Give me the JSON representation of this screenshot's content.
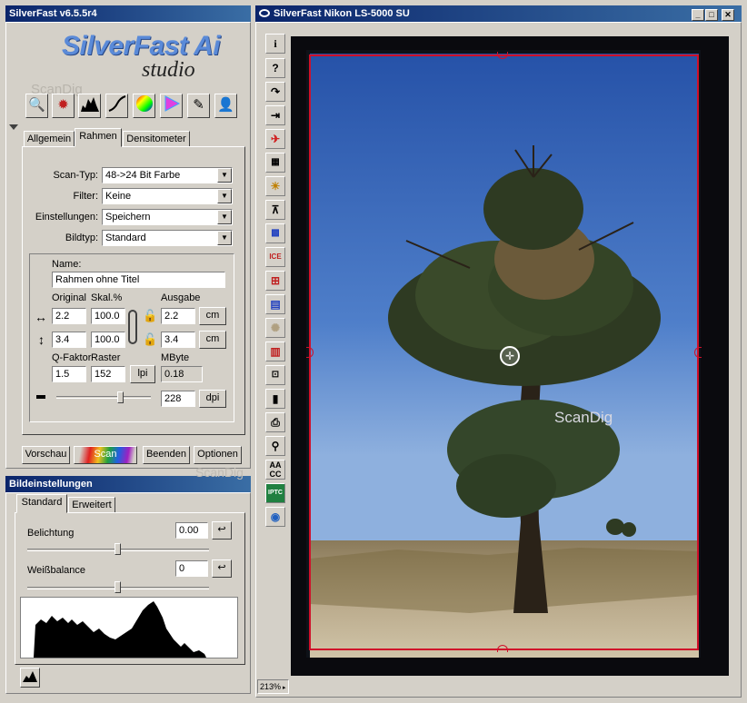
{
  "left_window": {
    "title": "SilverFast v6.5.5r4",
    "logo_main": "SilverFast Ai",
    "logo_sub": "studio",
    "watermark": "ScanDig",
    "tabs": [
      "Allgemein",
      "Rahmen",
      "Densitometer"
    ],
    "active_tab": "Rahmen",
    "scan_typ_label": "Scan-Typ:",
    "scan_typ_value": "48->24 Bit Farbe",
    "filter_label": "Filter:",
    "filter_value": "Keine",
    "einstellungen_label": "Einstellungen:",
    "einstellungen_value": "Speichern",
    "bildtyp_label": "Bildtyp:",
    "bildtyp_value": "Standard",
    "name_label": "Name:",
    "name_value": "Rahmen ohne Titel",
    "col_original": "Original",
    "col_skal": "Skal.%",
    "col_ausgabe": "Ausgabe",
    "width_original": "2.2",
    "width_skal": "100.0",
    "width_ausgabe": "2.2",
    "width_unit": "cm",
    "height_original": "3.4",
    "height_skal": "100.0",
    "height_ausgabe": "3.4",
    "height_unit": "cm",
    "qfaktor_label": "Q-Faktor",
    "raster_label": "Raster",
    "mbyte_label": "MByte",
    "qfaktor_value": "1.5",
    "raster_value": "152",
    "raster_unit": "lpi",
    "mbyte_value": "0.18",
    "resolution_value": "228",
    "resolution_unit": "dpi",
    "resolution_slider_level": 0.68,
    "btn_vorschau": "Vorschau",
    "btn_scan": "Scan",
    "btn_beenden": "Beenden",
    "btn_optionen": "Optionen"
  },
  "bild_panel": {
    "title": "Bildeinstellungen",
    "tabs": [
      "Standard",
      "Erweitert"
    ],
    "belichtung_label": "Belichtung",
    "belichtung_value": "0.00",
    "belichtung_level": 0.5,
    "weissbalance_label": "Weißbalance",
    "weissbalance_value": "0",
    "weissbalance_level": 0.5,
    "watermark": "ScanDig"
  },
  "right_window": {
    "title": "SilverFast Nikon LS-5000 SU",
    "zoom": "213%",
    "watermark": "ScanDig",
    "colors": {
      "frame": "#d0102a",
      "sky_top": "#2f5fb8",
      "sky_bottom": "#7fa3d6",
      "ground": "#b9a889",
      "titlebar": "#0a246a"
    }
  },
  "toolbar_icons": [
    "zoom-icon",
    "aperture-icon",
    "histogram-icon",
    "gradation-curve-icon",
    "color-wheel-icon",
    "selective-color-icon",
    "pipette-icon",
    "expert-icon"
  ],
  "side_icons": [
    "info-icon",
    "help-icon",
    "rotate-icon",
    "flip-icon",
    "plane-icon",
    "grain-icon",
    "brightness-icon",
    "filter-icon",
    "sharpen-icon",
    "ice-icon",
    "dust-icon",
    "multi-icon",
    "sun-icon",
    "cam-icon",
    "crop-icon",
    "lock-icon",
    "print-icon",
    "scanner-icon",
    "aacc-icon",
    "iptc-icon",
    "rotate-view-icon"
  ]
}
